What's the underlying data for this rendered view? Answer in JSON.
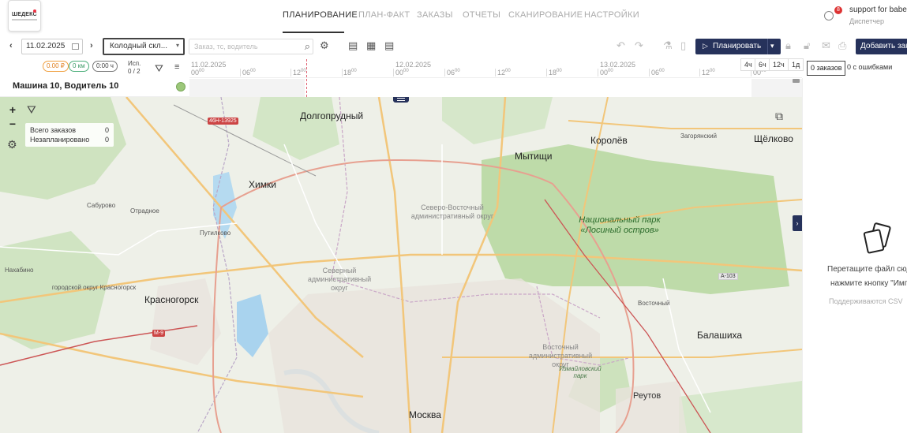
{
  "app": {
    "logo_text": "ШЕДЕКС",
    "nav": [
      {
        "label": "ПЛАНИРОВАНИЕ",
        "active": true
      },
      {
        "label": "ПЛАН-ФАКТ",
        "active": false
      },
      {
        "label": "ЗАКАЗЫ",
        "active": false
      },
      {
        "label": "ОТЧЕТЫ",
        "active": false
      },
      {
        "label": "СКАНИРОВАНИЕ",
        "active": false
      },
      {
        "label": "НАСТРОЙКИ",
        "active": false
      }
    ],
    "user": {
      "name": "support for baber",
      "role": "Диспетчер",
      "badge": "8"
    }
  },
  "toolbar": {
    "date": "11.02.2025",
    "warehouse": "Колодный скл...",
    "search_placeholder": "Заказ, тс, водитель",
    "plan_button": "Планировать",
    "add_button": "Добавить зак"
  },
  "stats": {
    "cost": "0.00 ₽",
    "distance": "0 км",
    "duration": "0:00 ч",
    "isp_label": "Исп.",
    "isp_value": "0 / 2"
  },
  "timeline": {
    "dates": [
      "11.02.2025",
      "12.02.2025",
      "13.02.2025"
    ],
    "hours": [
      "00",
      "06",
      "12",
      "18",
      "00",
      "06",
      "12",
      "18",
      "00",
      "06",
      "12",
      "18",
      "00"
    ],
    "scales": [
      "4ч",
      "6ч",
      "12ч",
      "1д"
    ],
    "orders_tab": "0 заказов",
    "errors_tab": "0 с ошибками"
  },
  "vehicle": {
    "name": "Машина 10, Водитель 10"
  },
  "map": {
    "panel": {
      "total_label": "Всего заказов",
      "total_value": "0",
      "unplanned_label": "Незапланировано",
      "unplanned_value": "0"
    },
    "labels": {
      "dolgoprudny": "Долгопрудный",
      "khimki": "Химки",
      "mytishchi": "Мытищи",
      "korolev": "Королёв",
      "zagoryansky": "Загорянский",
      "shchelkovo": "Щёлково",
      "sabourovo": "Сабурово",
      "otradnoe": "Отрадное",
      "putilkovo": "Путилково",
      "nakhabino": "Нахабино",
      "krasnogorsk": "Красногорск",
      "krasnogorsk_district": "городской округ Красногорск",
      "moskva": "Москва",
      "balashikha": "Балашиха",
      "reutov": "Реутов",
      "vostochny": "Восточный",
      "svao": "Северо-Восточный административный округ",
      "sao": "Северный административный округ",
      "vao": "Восточный административный округ",
      "losiny": "Национальный парк «Лосиный остров»",
      "izmailovsky": "Измайловский парк"
    },
    "badges": {
      "route_46n": "46Н-13925",
      "m9": "М-9",
      "a103": "А-103"
    }
  },
  "right_panel": {
    "drop_line1": "Перетащите файл сюда или",
    "drop_line2": "нажмите кнопку \"Импорт\"",
    "supported": "Поддерживаются CSV"
  }
}
